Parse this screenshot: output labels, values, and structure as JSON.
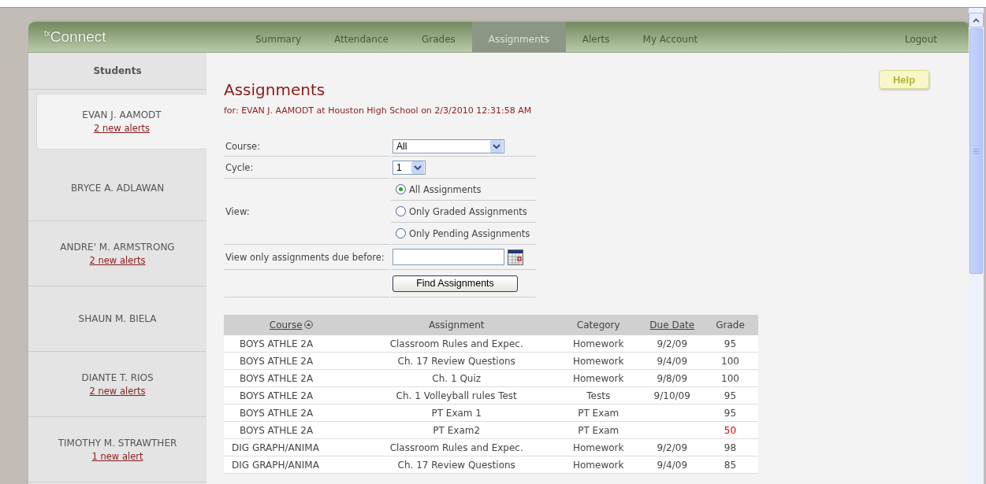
{
  "logo": "$^{tx}$Connect",
  "nav": [
    {
      "label": "Summary",
      "selected": false
    },
    {
      "label": "Attendance",
      "selected": false
    },
    {
      "label": "Grades",
      "selected": false
    },
    {
      "label": "Assignments",
      "selected": true
    },
    {
      "label": "Alerts",
      "selected": false
    },
    {
      "label": "My Account",
      "selected": false
    }
  ],
  "logout": "Logout",
  "sidebar": {
    "title": "Students",
    "students": [
      {
        "name": "EVAN J. AAMODT",
        "alerts": "2 new alerts",
        "selected": true
      },
      {
        "name": "BRYCE A. ADLAWAN",
        "selected": false
      },
      {
        "name": "ANDRE' M. ARMSTRONG",
        "alerts": "2 new alerts",
        "selected": false
      },
      {
        "name": "SHAUN M. BIELA",
        "selected": false
      },
      {
        "name": "DIANTE T. RIOS",
        "alerts": "2 new alerts",
        "selected": false
      },
      {
        "name": "TIMOTHY M. STRAWTHER",
        "alerts": "1 new alert",
        "selected": false
      }
    ]
  },
  "title": "Assignments",
  "subtitle": "for: EVAN J. AAMODT at Houston High School on 2/3/2010 12:31:58 AM",
  "help": "Help",
  "form": {
    "course": {
      "label": "Course:",
      "value": "All"
    },
    "cycle": {
      "label": "Cycle:",
      "value": "1"
    },
    "view": {
      "label": "View:",
      "options": [
        {
          "label": "All Assignments",
          "selected": true
        },
        {
          "label": "Only Graded Assignments",
          "selected": false
        },
        {
          "label": "Only Pending Assignments",
          "selected": false
        }
      ]
    },
    "due_before": {
      "label": "View only assignments due before:"
    },
    "submit": "Find Assignments"
  },
  "table": {
    "columns": [
      {
        "label": "Course",
        "link": true,
        "sorted": true
      },
      {
        "label": "Assignment",
        "link": false,
        "sorted": false
      },
      {
        "label": "Category",
        "link": false,
        "sorted": false
      },
      {
        "label": "Due Date",
        "link": true,
        "sorted": false
      },
      {
        "label": "Grade",
        "link": false,
        "sorted": false
      }
    ],
    "rows": [
      {
        "cells": [
          "BOYS ATHLE 2A",
          "Classroom Rules and Expec.",
          "Homework",
          "9/2/09",
          "95"
        ],
        "low": false
      },
      {
        "cells": [
          "BOYS ATHLE 2A",
          "Ch. 17 Review Questions",
          "Homework",
          "9/4/09",
          "100"
        ],
        "low": false
      },
      {
        "cells": [
          "BOYS ATHLE 2A",
          "Ch. 1 Quiz",
          "Homework",
          "9/8/09",
          "100"
        ],
        "low": false
      },
      {
        "cells": [
          "BOYS ATHLE 2A",
          "Ch. 1 Volleyball rules Test",
          "Tests",
          "9/10/09",
          "95"
        ],
        "low": false
      },
      {
        "cells": [
          "BOYS ATHLE 2A",
          "PT Exam 1",
          "PT Exam",
          "",
          "95"
        ],
        "low": false
      },
      {
        "cells": [
          "BOYS ATHLE 2A",
          "PT Exam2",
          "PT Exam",
          "",
          "50"
        ],
        "low": true
      },
      {
        "cells": [
          "DIG GRAPH/ANIMA",
          "Classroom Rules and Expec.",
          "Homework",
          "9/2/09",
          "98"
        ],
        "low": false
      },
      {
        "cells": [
          "DIG GRAPH/ANIMA",
          "Ch. 17 Review Questions",
          "Homework",
          "9/4/09",
          "85"
        ],
        "low": false
      }
    ]
  }
}
